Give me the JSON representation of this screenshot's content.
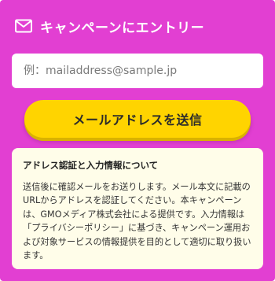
{
  "header": {
    "icon": "mail-icon",
    "title": "キャンペーンにエントリー"
  },
  "form": {
    "email_placeholder": "例：mailaddress@sample.jp",
    "email_value": "",
    "submit_label": "メールアドレスを送信"
  },
  "notice": {
    "title": "アドレス認証と入力情報について",
    "body": "送信後に確認メールをお送りします。メール本文に記載のURLからアドレスを認証してください。本キャンペーンは、GMOメディア株式会社による提供です。入力情報は「プライバシーポリシー」に基づき、キャンペーン運用および対象サービスの情報提供を目的として適切に取り扱います。"
  },
  "colors": {
    "panel_background": "#e23fd2",
    "button_background": "#ffd400",
    "notice_background": "#fffde9",
    "header_text": "#ffffff"
  }
}
